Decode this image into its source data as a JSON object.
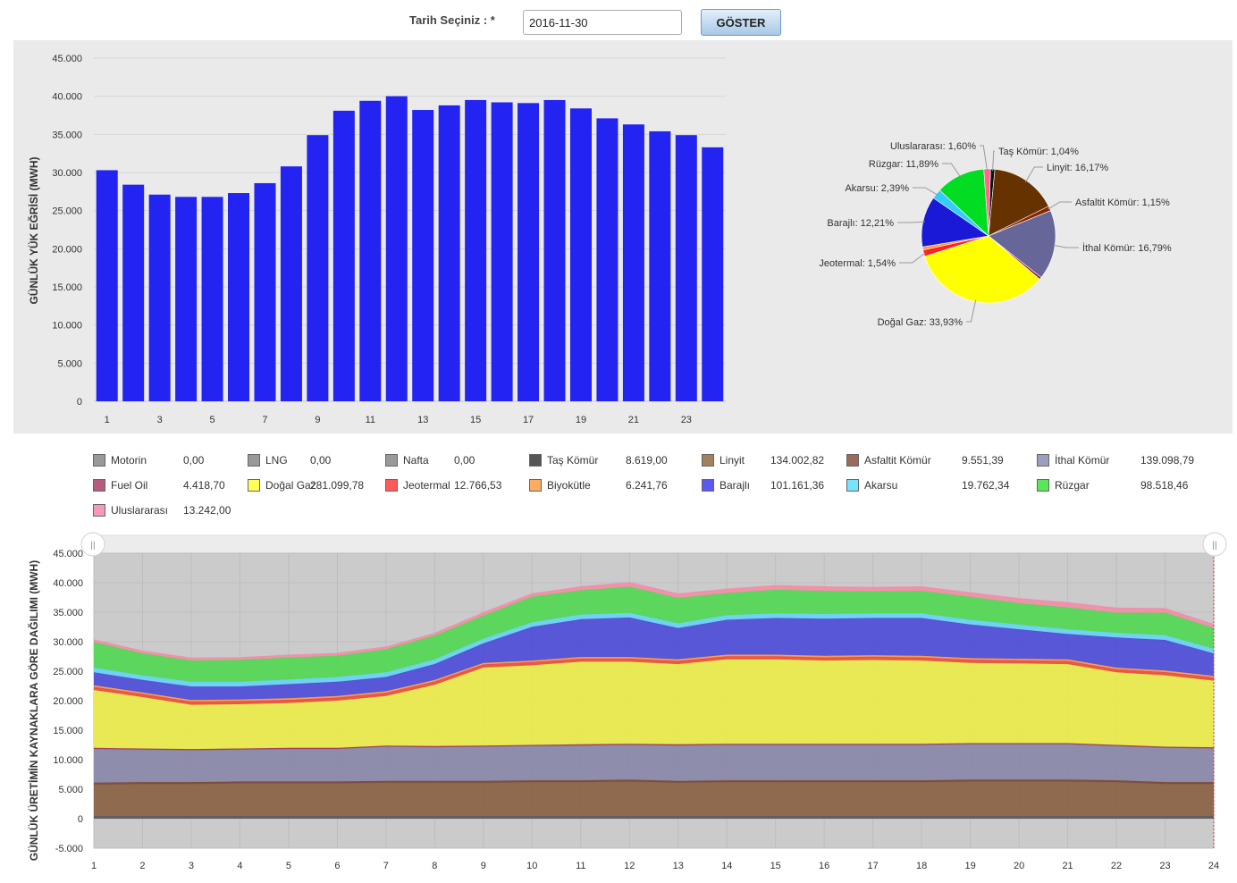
{
  "form": {
    "date_label": "Tarih Seçiniz : *",
    "date_value": "2016-11-30",
    "show_button": "GÖSTER"
  },
  "chart_data": [
    {
      "type": "bar",
      "ylabel": "GÜNLÜK YÜK EĞRİSİ (MWH)",
      "ylim": [
        0,
        45000
      ],
      "y_ticks": [
        "0",
        "5.000",
        "10.000",
        "15.000",
        "20.000",
        "25.000",
        "30.000",
        "35.000",
        "40.000",
        "45.000"
      ],
      "x_ticks": [
        "1",
        "3",
        "5",
        "7",
        "9",
        "11",
        "13",
        "15",
        "17",
        "19",
        "21",
        "23"
      ],
      "categories": [
        "1",
        "2",
        "3",
        "4",
        "5",
        "6",
        "7",
        "8",
        "9",
        "10",
        "11",
        "12",
        "13",
        "14",
        "15",
        "16",
        "17",
        "18",
        "19",
        "20",
        "21",
        "22",
        "23",
        "24"
      ],
      "values": [
        30300,
        28400,
        27100,
        26800,
        26800,
        27300,
        28600,
        30800,
        34900,
        38100,
        39400,
        40000,
        38200,
        38800,
        39500,
        39200,
        39100,
        39500,
        38400,
        37100,
        36300,
        35400,
        34900,
        33300
      ],
      "color": "#2323f2",
      "grid": true
    },
    {
      "type": "pie",
      "slices": [
        {
          "label": "Taş Kömür: 1,04%",
          "value": 1.04,
          "color": "#111111"
        },
        {
          "label": "Linyit: 16,17%",
          "value": 16.17,
          "color": "#663300"
        },
        {
          "label": "Asfaltit Kömür: 1,15%",
          "value": 1.15,
          "color": "#8b2500"
        },
        {
          "label": "İthal Kömür: 16,79%",
          "value": 16.79,
          "color": "#666699"
        },
        {
          "label": "Fuel Oil",
          "value": 0.53,
          "color": "#990033"
        },
        {
          "label": "Doğal Gaz: 33,93%",
          "value": 33.93,
          "color": "#ffff00"
        },
        {
          "label": "Jeotermal: 1,54%",
          "value": 1.54,
          "color": "#ff2020"
        },
        {
          "label": "Biyokütle",
          "value": 0.75,
          "color": "#ff9933"
        },
        {
          "label": "Barajlı: 12,21%",
          "value": 12.21,
          "color": "#1a1ad6"
        },
        {
          "label": "Akarsu: 2,39%",
          "value": 2.39,
          "color": "#33ccff"
        },
        {
          "label": "Rüzgar: 11,89%",
          "value": 11.89,
          "color": "#00dd22"
        },
        {
          "label": "Uluslararası: 1,60%",
          "value": 1.6,
          "color": "#ff6688"
        }
      ]
    },
    {
      "type": "area",
      "stacked": true,
      "ylabel": "GÜNLÜK ÜRETİMİN KAYNAKLARA GÖRE DAĞILIMI (MWH)",
      "ylim": [
        -5000,
        45000
      ],
      "y_ticks": [
        "-5.000",
        "0",
        "5.000",
        "10.000",
        "15.000",
        "20.000",
        "25.000",
        "30.000",
        "35.000",
        "40.000",
        "45.000"
      ],
      "x": [
        1,
        2,
        3,
        4,
        5,
        6,
        7,
        8,
        9,
        10,
        11,
        12,
        13,
        14,
        15,
        16,
        17,
        18,
        19,
        20,
        21,
        22,
        23,
        24
      ],
      "totals": [
        30300,
        28400,
        27100,
        26900,
        26800,
        27300,
        28600,
        30800,
        34900,
        38000,
        39300,
        39900,
        38100,
        38700,
        39300,
        39100,
        39000,
        39300,
        38300,
        37100,
        36200,
        35300,
        34800,
        33200
      ],
      "series": [
        {
          "name": "Taş Kömür",
          "color": "#555566",
          "values": [
            400,
            400,
            400,
            400,
            400,
            400,
            400,
            400,
            400,
            400,
            400,
            400,
            400,
            400,
            400,
            400,
            400,
            400,
            400,
            400,
            400,
            400,
            400,
            400
          ]
        },
        {
          "name": "Linyit",
          "color": "#8b6448",
          "values": [
            5400,
            5500,
            5500,
            5600,
            5600,
            5600,
            5700,
            5700,
            5700,
            5800,
            5800,
            5900,
            5700,
            5800,
            5800,
            5800,
            5800,
            5800,
            5900,
            5900,
            5900,
            5800,
            5500,
            5500
          ]
        },
        {
          "name": "Asfaltit Kömür",
          "color": "#7a4a3a",
          "values": [
            300,
            300,
            300,
            300,
            300,
            300,
            300,
            300,
            300,
            300,
            300,
            300,
            300,
            300,
            300,
            300,
            300,
            300,
            300,
            300,
            300,
            300,
            300,
            300
          ]
        },
        {
          "name": "İthal Kömür",
          "color": "#8a89aa",
          "values": [
            5700,
            5500,
            5400,
            5400,
            5500,
            5500,
            5800,
            5700,
            5800,
            5800,
            5900,
            5900,
            6000,
            6000,
            6000,
            6000,
            6000,
            6000,
            6000,
            6000,
            6000,
            5800,
            5800,
            5700
          ]
        },
        {
          "name": "Fuel Oil",
          "color": "#a04060",
          "values": [
            200,
            200,
            200,
            200,
            200,
            200,
            200,
            200,
            200,
            200,
            200,
            200,
            200,
            200,
            200,
            200,
            200,
            200,
            200,
            200,
            200,
            200,
            200,
            200
          ]
        },
        {
          "name": "Doğal Gaz",
          "color": "#eaea4e",
          "values": [
            9800,
            8700,
            7500,
            7500,
            7600,
            8000,
            8400,
            10400,
            13200,
            13500,
            14000,
            13900,
            13600,
            14300,
            14300,
            14100,
            14200,
            14100,
            13600,
            13500,
            13400,
            12300,
            12100,
            11300
          ]
        },
        {
          "name": "Jeotermal",
          "color": "#ea5040",
          "values": [
            550,
            550,
            550,
            550,
            550,
            550,
            550,
            550,
            550,
            550,
            550,
            550,
            550,
            550,
            550,
            550,
            550,
            550,
            550,
            550,
            550,
            550,
            550,
            550
          ]
        },
        {
          "name": "Biyokütle",
          "color": "#f5a050",
          "values": [
            260,
            260,
            260,
            260,
            260,
            260,
            260,
            260,
            260,
            260,
            260,
            260,
            260,
            260,
            260,
            260,
            260,
            260,
            260,
            260,
            260,
            260,
            260,
            260
          ]
        },
        {
          "name": "Barajlı",
          "color": "#5050d8",
          "values": [
            2200,
            2100,
            2300,
            2200,
            2400,
            2400,
            2400,
            2700,
            3300,
            5700,
            6400,
            6700,
            5300,
            5900,
            6200,
            6300,
            6300,
            6400,
            5700,
            5000,
            4300,
            5100,
            5200,
            3800
          ]
        },
        {
          "name": "Akarsu",
          "color": "#6ad3f0",
          "values": [
            800,
            800,
            800,
            800,
            800,
            800,
            800,
            800,
            800,
            800,
            800,
            800,
            800,
            800,
            800,
            800,
            800,
            800,
            800,
            800,
            800,
            800,
            800,
            800
          ]
        },
        {
          "name": "Rüzgar",
          "color": "#55d655",
          "values": [
            4300,
            3700,
            3600,
            3700,
            3700,
            3600,
            3900,
            4000,
            3900,
            4300,
            4100,
            4400,
            4300,
            3700,
            4000,
            3900,
            3700,
            3800,
            3900,
            3600,
            3700,
            3400,
            3800,
            3500
          ]
        },
        {
          "name": "Uluslararası",
          "color": "#ef8fa8",
          "values": [
            400,
            400,
            400,
            400,
            400,
            400,
            400,
            400,
            500,
            500,
            600,
            700,
            700,
            700,
            700,
            700,
            700,
            700,
            700,
            800,
            800,
            800,
            700,
            600
          ]
        }
      ]
    }
  ],
  "legend": [
    {
      "name": "Motorin",
      "value": "0,00",
      "color": "#999999"
    },
    {
      "name": "LNG",
      "value": "0,00",
      "color": "#999999"
    },
    {
      "name": "Nafta",
      "value": "0,00",
      "color": "#999999"
    },
    {
      "name": "Taş Kömür",
      "value": "8.619,00",
      "color": "#555555"
    },
    {
      "name": "Linyit",
      "value": "134.002,82",
      "color": "#a0825e"
    },
    {
      "name": "Asfaltit Kömür",
      "value": "9.551,39",
      "color": "#9a6a5a"
    },
    {
      "name": "İthal Kömür",
      "value": "139.098,79",
      "color": "#9d9dc2"
    },
    {
      "name": "Fuel Oil",
      "value": "4.418,70",
      "color": "#b65a7e"
    },
    {
      "name": "Doğal Gaz",
      "value": "281.099,78",
      "color": "#ffff55"
    },
    {
      "name": "Jeotermal",
      "value": "12.766,53",
      "color": "#ff5a5a"
    },
    {
      "name": "Biyokütle",
      "value": "6.241,76",
      "color": "#ffac60"
    },
    {
      "name": "Barajlı",
      "value": "101.161,36",
      "color": "#5a5aee"
    },
    {
      "name": "Akarsu",
      "value": "19.762,34",
      "color": "#77e3ff"
    },
    {
      "name": "Rüzgar",
      "value": "98.518,46",
      "color": "#5ae65a"
    },
    {
      "name": "Uluslararası",
      "value": "13.242,00",
      "color": "#f59ab5"
    }
  ]
}
